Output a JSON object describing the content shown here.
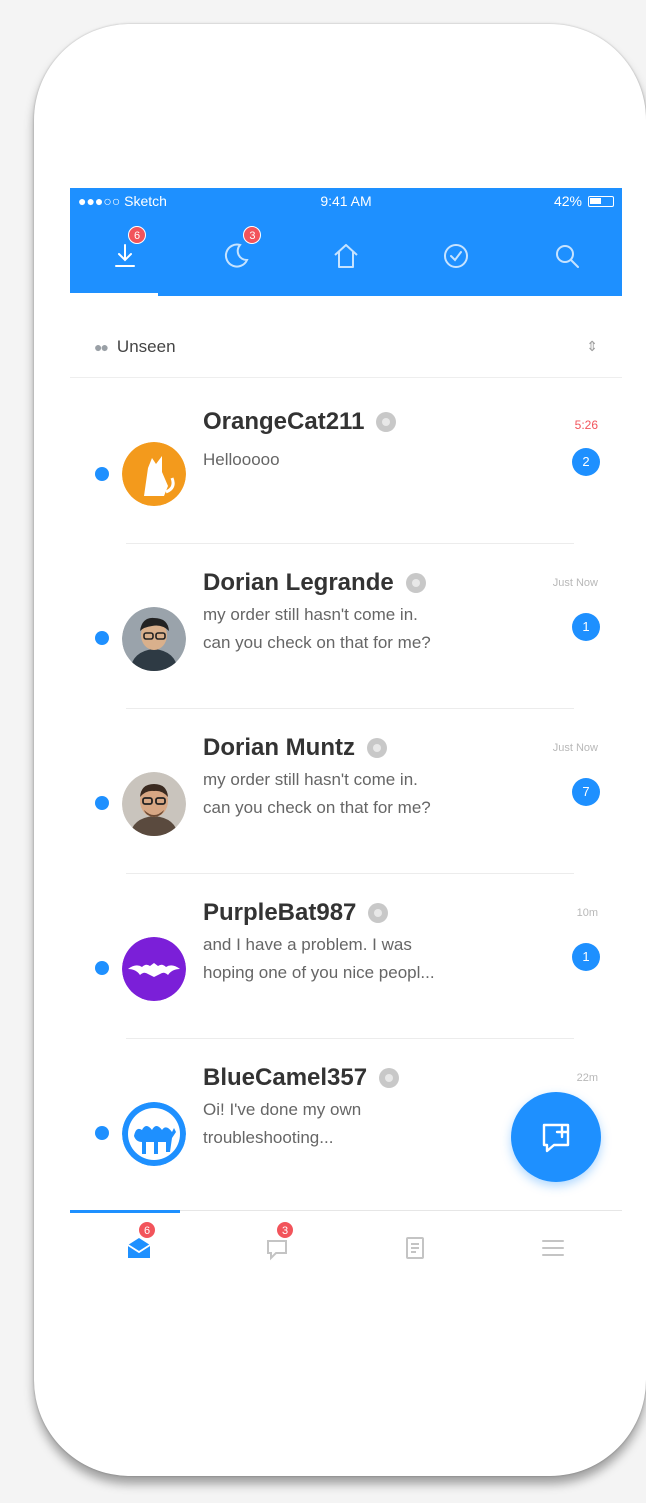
{
  "colors": {
    "accent": "#1e90ff",
    "badge": "#f2545b",
    "text_dark": "#333333",
    "text_muted": "#666666"
  },
  "status_bar": {
    "carrier": "●●●○○ Sketch",
    "time": "9:41 AM",
    "battery": "42%"
  },
  "top_tabs": [
    {
      "icon": "download-icon",
      "badge": "6",
      "active": true
    },
    {
      "icon": "moon-icon",
      "badge": "3",
      "active": false
    },
    {
      "icon": "home-icon",
      "badge": "",
      "active": false
    },
    {
      "icon": "check-circle-icon",
      "badge": "",
      "active": false
    },
    {
      "icon": "search-icon",
      "badge": "",
      "active": false
    }
  ],
  "filter": {
    "label": "Unseen"
  },
  "conversations": [
    {
      "name": "OrangeCat211",
      "preview": [
        "Hellooooo"
      ],
      "time": "5:26",
      "count": "2",
      "avatar": "orange-cat-avatar-icon"
    },
    {
      "name": "Dorian Legrande",
      "preview": [
        "my order still hasn't come in.",
        "can you check on that for me?"
      ],
      "time": "Just Now",
      "count": "1",
      "avatar": "dorian-legrande-avatar"
    },
    {
      "name": "Dorian Muntz",
      "preview": [
        "my order still hasn't come in.",
        "can you check on that for me?"
      ],
      "time": "Just Now",
      "count": "7",
      "avatar": "dorian-muntz-avatar"
    },
    {
      "name": "PurpleBat987",
      "preview": [
        "and I have a problem. I was",
        "hoping one of you nice peopl..."
      ],
      "time": "10m",
      "count": "1",
      "avatar": "purple-bat-avatar-icon"
    },
    {
      "name": "BlueCamel357",
      "preview": [
        "Oi! I've done my own",
        "troubleshooting..."
      ],
      "time": "22m",
      "count": "",
      "avatar": "blue-camel-avatar-icon"
    }
  ],
  "bottom_nav": [
    {
      "icon": "inbox-icon",
      "badge": "6",
      "active": true
    },
    {
      "icon": "chat-icon",
      "badge": "3",
      "active": false
    },
    {
      "icon": "document-icon",
      "badge": "",
      "active": false
    },
    {
      "icon": "menu-icon",
      "badge": "",
      "active": false
    }
  ]
}
